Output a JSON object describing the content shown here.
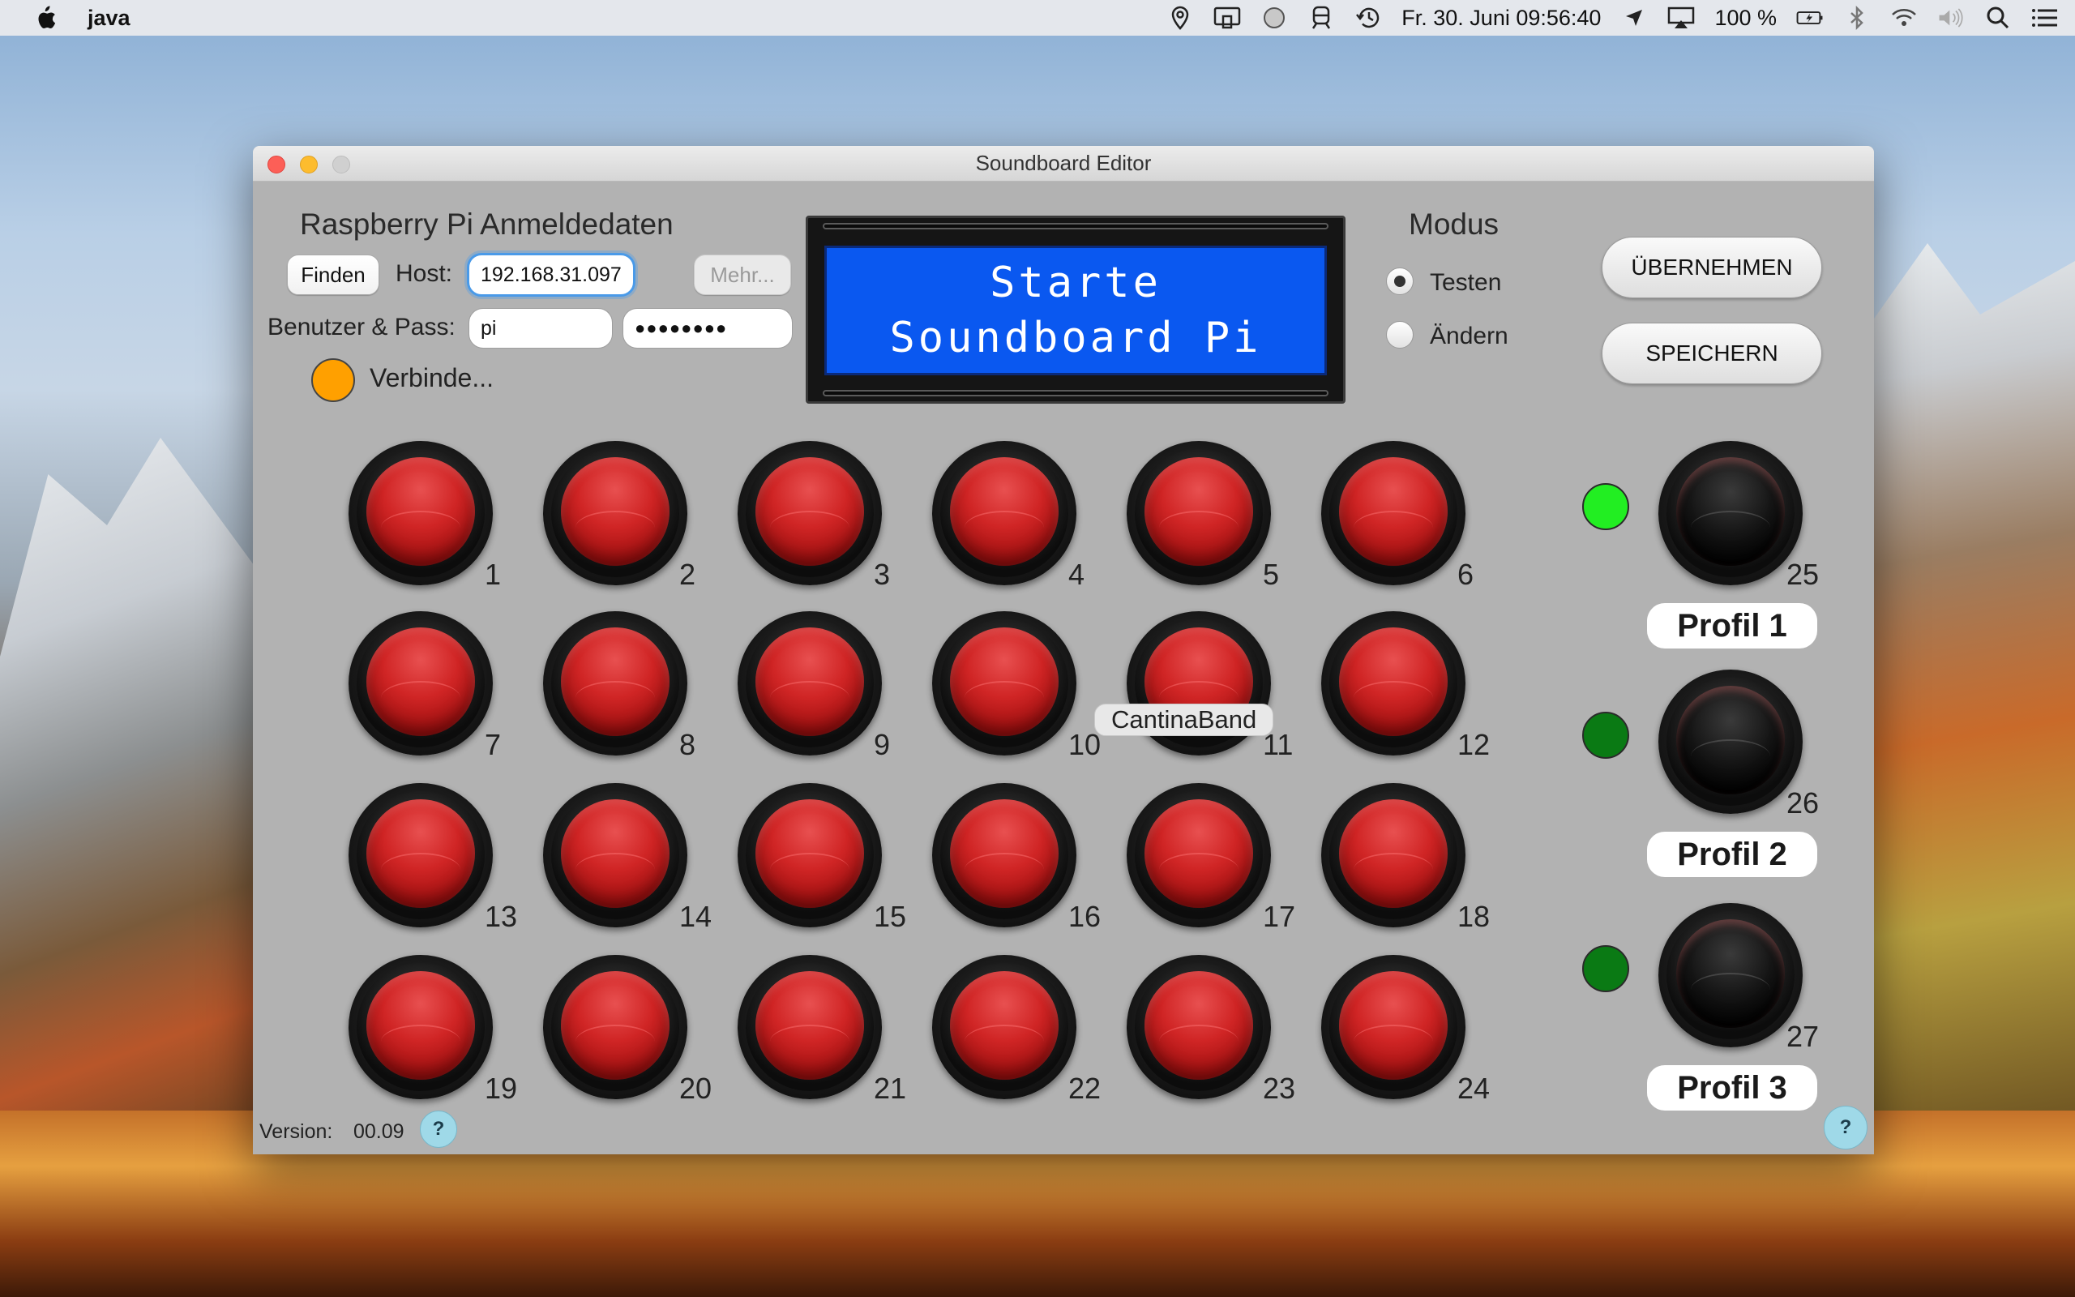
{
  "menubar": {
    "app_name": "java",
    "datetime": "Fr. 30. Juni  09:56:40",
    "battery": "100 %"
  },
  "window": {
    "title": "Soundboard Editor"
  },
  "credentials": {
    "heading": "Raspberry Pi Anmeldedaten",
    "find_button": "Finden",
    "host_label": "Host:",
    "host_value": "192.168.31.097",
    "more_button": "Mehr...",
    "user_pass_label": "Benutzer & Pass:",
    "user_value": "pi",
    "pass_value": "●●●●●●●●",
    "status_text": "Verbinde...",
    "status_color": "#ffa000"
  },
  "lcd": {
    "line1": "Starte",
    "line2": "Soundboard Pi",
    "color": "#0a58f0"
  },
  "mode": {
    "heading": "Modus",
    "options": [
      {
        "label": "Testen",
        "selected": true
      },
      {
        "label": "Ändern",
        "selected": false
      }
    ]
  },
  "actions": {
    "apply": "ÜBERNEHMEN",
    "save": "SPEICHERN"
  },
  "sound_buttons": [
    "1",
    "2",
    "3",
    "4",
    "5",
    "6",
    "7",
    "8",
    "9",
    "10",
    "11",
    "12",
    "13",
    "14",
    "15",
    "16",
    "17",
    "18",
    "19",
    "20",
    "21",
    "22",
    "23",
    "24"
  ],
  "hover_tooltip": "CantinaBand",
  "profiles": [
    {
      "number": "25",
      "label": "Profil 1",
      "indicator": "#22ee22"
    },
    {
      "number": "26",
      "label": "Profil 2",
      "indicator": "#0a7a14"
    },
    {
      "number": "27",
      "label": "Profil 3",
      "indicator": "#0a7a14"
    }
  ],
  "footer": {
    "version_label": "Version:",
    "version_value": "00.09",
    "help_glyph": "?"
  }
}
